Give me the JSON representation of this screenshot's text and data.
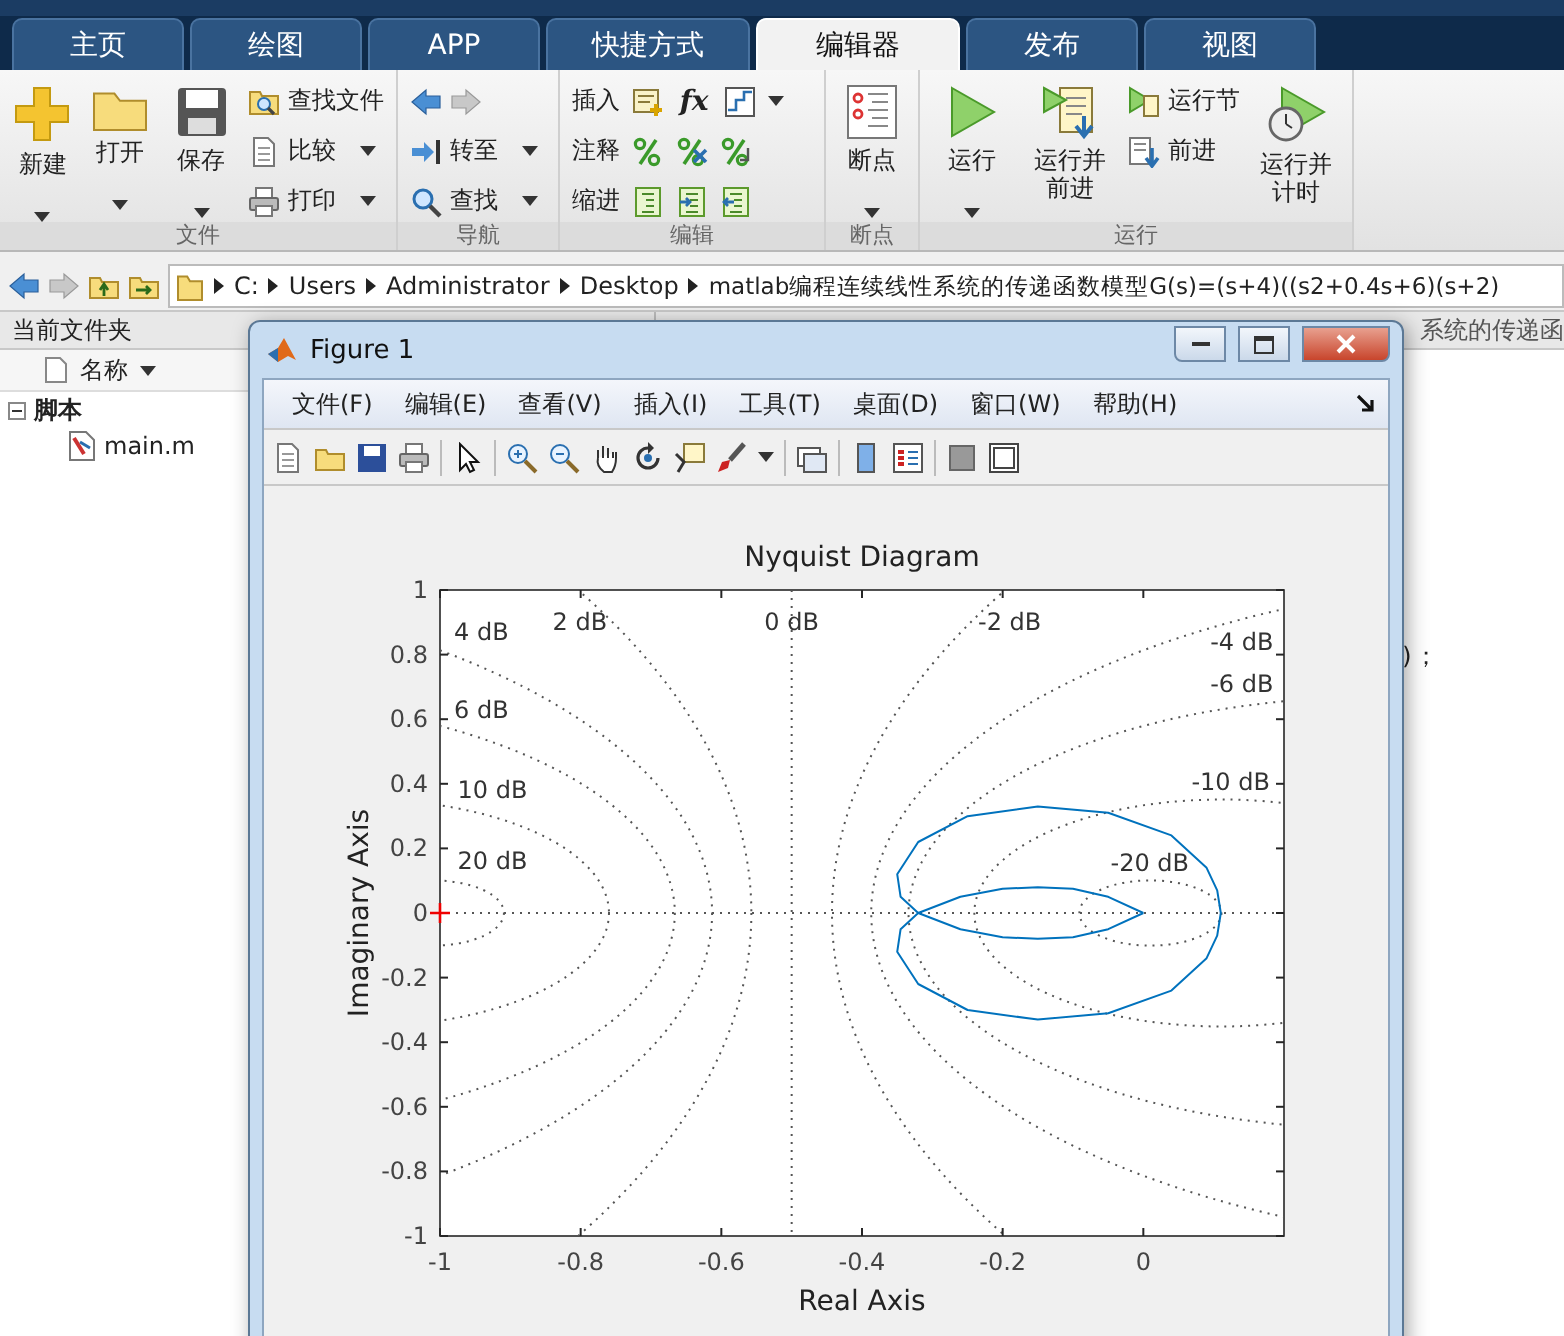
{
  "ribbon_tabs": [
    {
      "label": "主页",
      "selected": false
    },
    {
      "label": "绘图",
      "selected": false
    },
    {
      "label": "APP",
      "selected": false
    },
    {
      "label": "快捷方式",
      "selected": false
    },
    {
      "label": "编辑器",
      "selected": true
    },
    {
      "label": "发布",
      "selected": false
    },
    {
      "label": "视图",
      "selected": false
    }
  ],
  "ribbon_groups": [
    {
      "title": "文件",
      "items": [
        {
          "kind": "large",
          "label": "新建",
          "dropdown": true
        },
        {
          "kind": "large",
          "label": "打开",
          "dropdown": true
        },
        {
          "kind": "large",
          "label": "保存",
          "dropdown": true
        },
        {
          "kind": "stack",
          "items": [
            {
              "kind": "small",
              "label": "查找文件",
              "dropdown": false
            },
            {
              "kind": "small",
              "label": "比较",
              "dropdown": true
            },
            {
              "kind": "small",
              "label": "打印",
              "dropdown": true
            }
          ]
        }
      ]
    },
    {
      "title": "导航",
      "items": [
        {
          "kind": "stack",
          "items": [
            {
              "kind": "arrows"
            },
            {
              "kind": "small",
              "label": "转至",
              "dropdown": true
            },
            {
              "kind": "small",
              "label": "查找",
              "dropdown": true
            }
          ]
        }
      ]
    },
    {
      "title": "编辑",
      "items": [
        {
          "kind": "stack",
          "items": [
            {
              "kind": "row",
              "label": "插入",
              "text_icon": "fx",
              "dropdown": true
            },
            {
              "kind": "row",
              "label": "注释",
              "dropdown": false
            },
            {
              "kind": "row",
              "label": "缩进",
              "dropdown": false
            }
          ]
        }
      ]
    },
    {
      "title": "断点",
      "items": [
        {
          "kind": "large",
          "label": "断点",
          "dropdown": true
        }
      ]
    },
    {
      "title": "运行",
      "items": [
        {
          "kind": "large",
          "label": "运行",
          "dropdown": true
        },
        {
          "kind": "large",
          "label": "运行并前进",
          "dropdown": false
        },
        {
          "kind": "stack",
          "items": [
            {
              "kind": "small",
              "label": "运行节",
              "dropdown": false
            },
            {
              "kind": "small",
              "label": "前进",
              "dropdown": false
            }
          ]
        },
        {
          "kind": "large",
          "label": "运行并计时",
          "dropdown": false
        }
      ]
    }
  ],
  "address_bar": {
    "path": [
      "C:",
      "Users",
      "Administrator",
      "Desktop",
      "matlab编程连续线性系统的传递函数模型G(s)=(s+4)((s2+0.4s+6)(s+2)"
    ]
  },
  "current_folder": {
    "title": "当前文件夹",
    "column": "名称",
    "tree": [
      {
        "label": "脚本",
        "expanded": true,
        "children": [
          {
            "label": "main.m"
          }
        ]
      }
    ]
  },
  "editor": {
    "title": "系统的传递函",
    "visible_code": ")；"
  },
  "figure_window": {
    "title": "Figure 1",
    "menu": [
      "文件(F)",
      "编辑(E)",
      "查看(V)",
      "插入(I)",
      "工具(T)",
      "桌面(D)",
      "窗口(W)",
      "帮助(H)"
    ],
    "chart_data": {
      "type": "line",
      "title": "Nyquist Diagram",
      "xlabel": "Real Axis",
      "ylabel": "Imaginary Axis",
      "xlim": [
        -1,
        0.2
      ],
      "ylim": [
        -1,
        1
      ],
      "xticks": [
        -1,
        -0.8,
        -0.6,
        -0.4,
        -0.2,
        0
      ],
      "yticks": [
        -1,
        -0.8,
        -0.6,
        -0.4,
        -0.2,
        0,
        0.2,
        0.4,
        0.6,
        0.8,
        1
      ],
      "annotations": [
        "4 dB",
        "2 dB",
        "0 dB",
        "-2 dB",
        "-4 dB",
        "-6 dB",
        "-10 dB",
        "-20 dB",
        "6 dB",
        "10 dB",
        "20 dB"
      ]
    }
  }
}
